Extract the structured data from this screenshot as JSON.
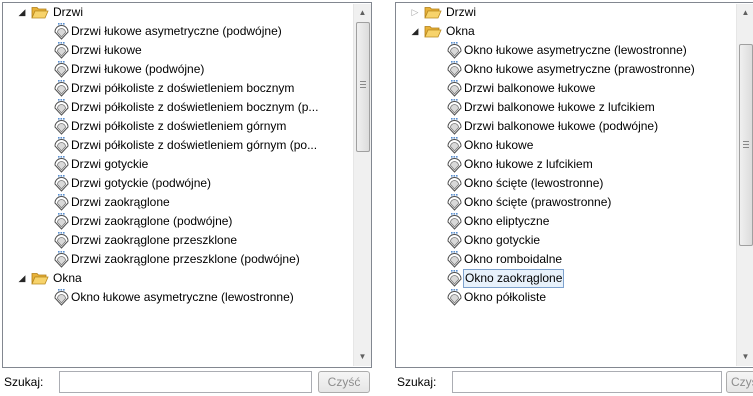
{
  "left_panel": {
    "rows": [
      {
        "type": "folder",
        "label": "Drzwi",
        "expanded": true
      },
      {
        "type": "item",
        "label": "Drzwi łukowe asymetryczne (podwójne)"
      },
      {
        "type": "item",
        "label": "Drzwi łukowe"
      },
      {
        "type": "item",
        "label": "Drzwi łukowe (podwójne)"
      },
      {
        "type": "item",
        "label": "Drzwi półkoliste z doświetleniem bocznym"
      },
      {
        "type": "item",
        "label": "Drzwi półkoliste z doświetleniem bocznym (p..."
      },
      {
        "type": "item",
        "label": "Drzwi półkoliste z doświetleniem górnym"
      },
      {
        "type": "item",
        "label": "Drzwi półkoliste z doświetleniem górnym (po..."
      },
      {
        "type": "item",
        "label": "Drzwi gotyckie"
      },
      {
        "type": "item",
        "label": "Drzwi gotyckie (podwójne)"
      },
      {
        "type": "item",
        "label": "Drzwi zaokrąglone"
      },
      {
        "type": "item",
        "label": "Drzwi zaokrąglone (podwójne)"
      },
      {
        "type": "item",
        "label": "Drzwi zaokrąglone przeszklone"
      },
      {
        "type": "item",
        "label": "Drzwi zaokrąglone przeszklone (podwójne)"
      },
      {
        "type": "folder",
        "label": "Okna",
        "expanded": true
      },
      {
        "type": "item",
        "label": "Okno łukowe asymetryczne (lewostronne)"
      }
    ],
    "search": {
      "label": "Szukaj:",
      "value": "",
      "clear_label": "Czyść"
    }
  },
  "right_panel": {
    "rows": [
      {
        "type": "folder",
        "label": "Drzwi",
        "expanded": false
      },
      {
        "type": "folder",
        "label": "Okna",
        "expanded": true
      },
      {
        "type": "item",
        "label": "Okno łukowe asymetryczne (lewostronne)"
      },
      {
        "type": "item",
        "label": "Okno łukowe asymetryczne (prawostronne)"
      },
      {
        "type": "item",
        "label": "Drzwi balkonowe łukowe"
      },
      {
        "type": "item",
        "label": "Drzwi balkonowe łukowe z lufcikiem"
      },
      {
        "type": "item",
        "label": "Drzwi balkonowe łukowe (podwójne)"
      },
      {
        "type": "item",
        "label": "Okno łukowe"
      },
      {
        "type": "item",
        "label": "Okno łukowe z lufcikiem"
      },
      {
        "type": "item",
        "label": "Okno ścięte (lewostronne)"
      },
      {
        "type": "item",
        "label": "Okno ścięte (prawostronne)"
      },
      {
        "type": "item",
        "label": "Okno eliptyczne"
      },
      {
        "type": "item",
        "label": "Okno gotyckie"
      },
      {
        "type": "item",
        "label": "Okno romboidalne"
      },
      {
        "type": "item",
        "label": "Okno zaokrąglone",
        "selected": true
      },
      {
        "type": "item",
        "label": "Okno półkoliste"
      }
    ],
    "search": {
      "label": "Szukaj:",
      "value": "",
      "clear_label": "Czyść"
    }
  },
  "colors": {
    "tree_border": "#828790",
    "selection_border": "#7da2ce",
    "selection_fill": "#e7f1fb",
    "folder_yellow": "#f4c94c",
    "clear_text": "#8d8d8d"
  },
  "icons": {
    "folder": "folder-open-icon",
    "item": "arch-shape-icon",
    "expanded": "expanded-triangle-icon",
    "collapsed": "collapsed-triangle-icon",
    "scroll_up": "scroll-up-arrow-icon",
    "scroll_down": "scroll-down-arrow-icon"
  },
  "scroll": {
    "left_position_fraction": 0.0,
    "right_position_fraction": 0.2
  }
}
